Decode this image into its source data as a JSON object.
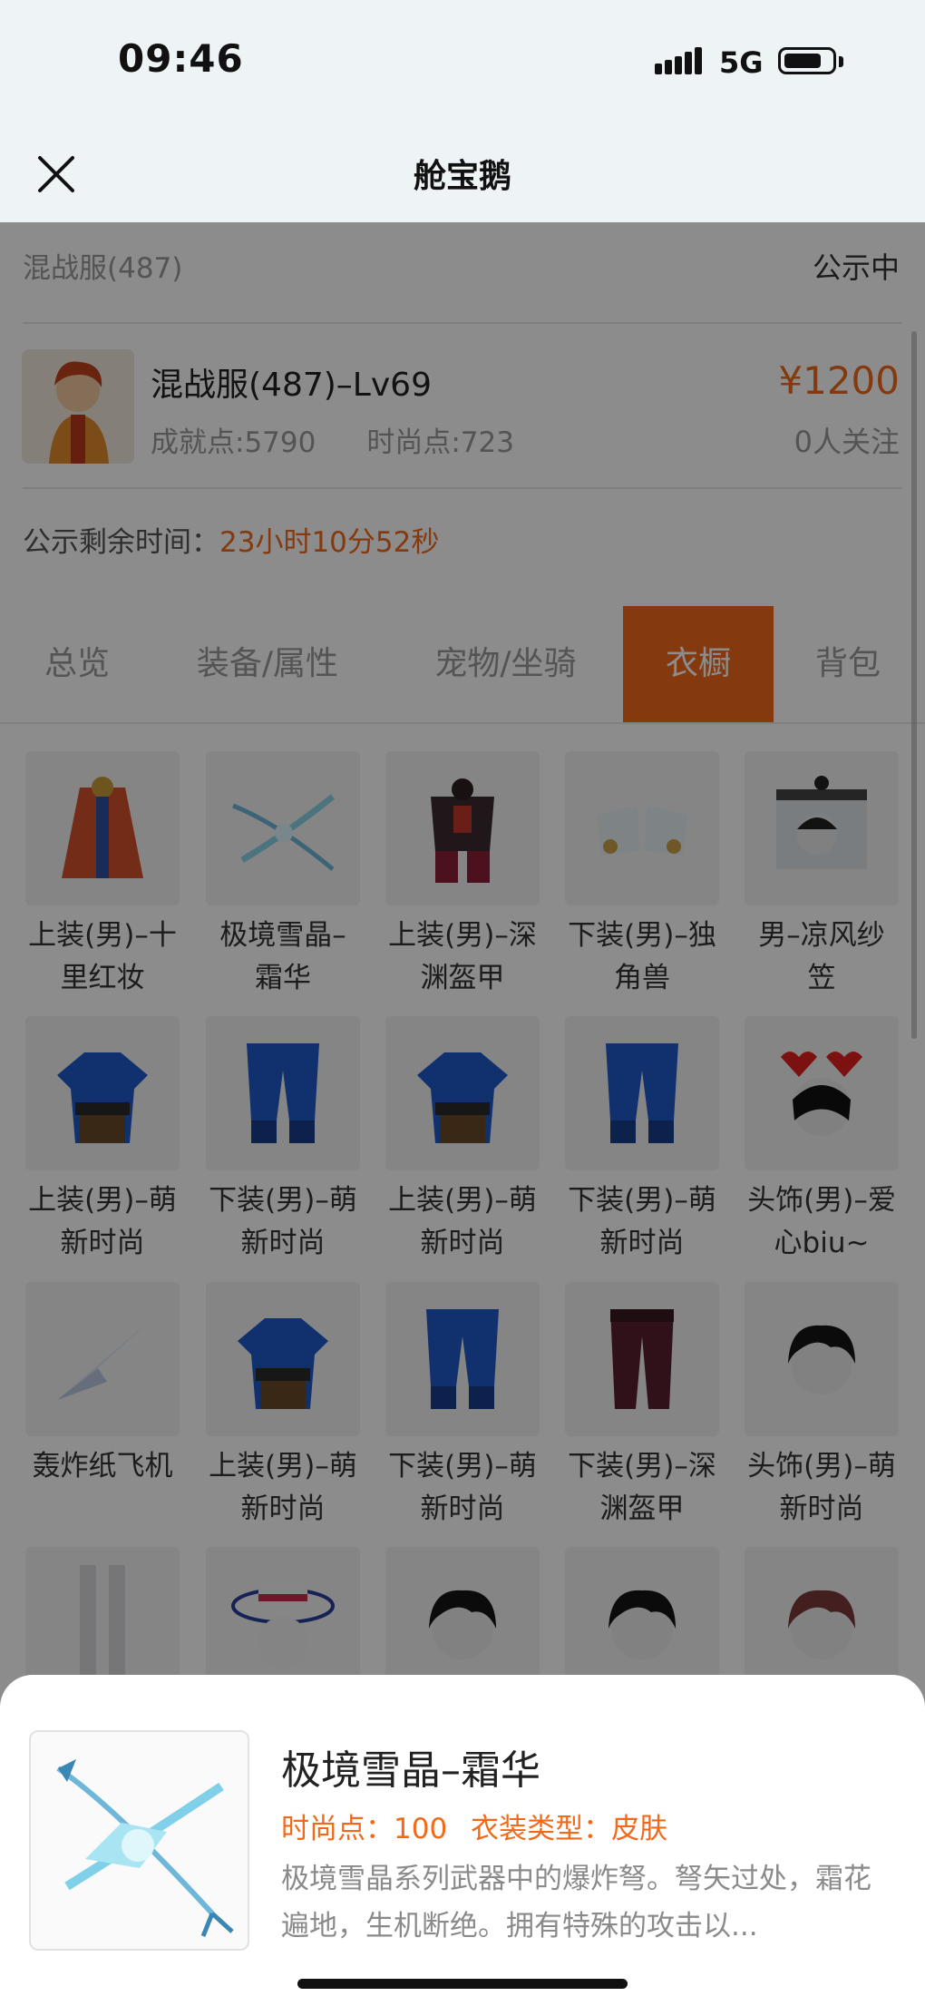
{
  "status_bar": {
    "time": "09:46",
    "network": "5G"
  },
  "nav": {
    "title": "舱宝鹅"
  },
  "server_row": {
    "server": "混战服(487)",
    "status": "公示中"
  },
  "character": {
    "name": "混战服(487)–Lv69",
    "achievement": "成就点:5790",
    "fashion": "时尚点:723",
    "price": "¥1200",
    "followers": "0人关注"
  },
  "countdown": {
    "label": "公示剩余时间：",
    "value": "23小时10分52秒"
  },
  "tabs": [
    {
      "label": "总览"
    },
    {
      "label": "装备/属性"
    },
    {
      "label": "宠物/坐骑"
    },
    {
      "label": "衣橱"
    },
    {
      "label": "背包"
    }
  ],
  "wardrobe": [
    {
      "line1": "上装(男)–十",
      "line2": "里红妆",
      "icon": "red-robe-icon"
    },
    {
      "line1": "极境雪晶–",
      "line2": "霜华",
      "icon": "crossbow-icon"
    },
    {
      "line1": "上装(男)–深",
      "line2": "渊盔甲",
      "icon": "dark-armor-icon"
    },
    {
      "line1": "下装(男)–独",
      "line2": "角兽",
      "icon": "boots-icon"
    },
    {
      "line1": "男–凉风纱",
      "line2": "笠",
      "icon": "hat-icon"
    },
    {
      "line1": "上装(男)–萌",
      "line2": "新时尚",
      "icon": "blue-robe-icon"
    },
    {
      "line1": "下装(男)–萌",
      "line2": "新时尚",
      "icon": "blue-pants-icon"
    },
    {
      "line1": "上装(男)–萌",
      "line2": "新时尚",
      "icon": "blue-robe-icon"
    },
    {
      "line1": "下装(男)–萌",
      "line2": "新时尚",
      "icon": "blue-pants-icon"
    },
    {
      "line1": "头饰(男)–爱",
      "line2": "心biu~",
      "icon": "heart-headband-icon"
    },
    {
      "line1": "轰炸纸飞机",
      "line2": "",
      "icon": "paper-plane-icon"
    },
    {
      "line1": "上装(男)–萌",
      "line2": "新时尚",
      "icon": "blue-robe-icon"
    },
    {
      "line1": "下装(男)–萌",
      "line2": "新时尚",
      "icon": "blue-pants-icon"
    },
    {
      "line1": "下装(男)–深",
      "line2": "渊盔甲",
      "icon": "dark-pants-icon"
    },
    {
      "line1": "头饰(男)–萌",
      "line2": "新时尚",
      "icon": "hair-icon"
    },
    {
      "line1": "",
      "line2": "",
      "icon": "legs-icon"
    },
    {
      "line1": "",
      "line2": "",
      "icon": "straw-hat-icon"
    },
    {
      "line1": "",
      "line2": "",
      "icon": "hair-icon"
    },
    {
      "line1": "",
      "line2": "",
      "icon": "hair-icon"
    },
    {
      "line1": "",
      "line2": "",
      "icon": "red-hair-icon"
    }
  ],
  "sheet": {
    "title": "极境雪晶–霜华",
    "fashion_label": "时尚点：",
    "fashion_value": "100",
    "type_label": "衣装类型：",
    "type_value": "皮肤",
    "description": "极境雪晶系列武器中的爆炸弩。弩矢过处，霜花遍地，生机断绝。拥有特殊的攻击以..."
  },
  "colors": {
    "accent": "#f2691a",
    "overlay": "rgba(0,0,0,0.45)"
  }
}
